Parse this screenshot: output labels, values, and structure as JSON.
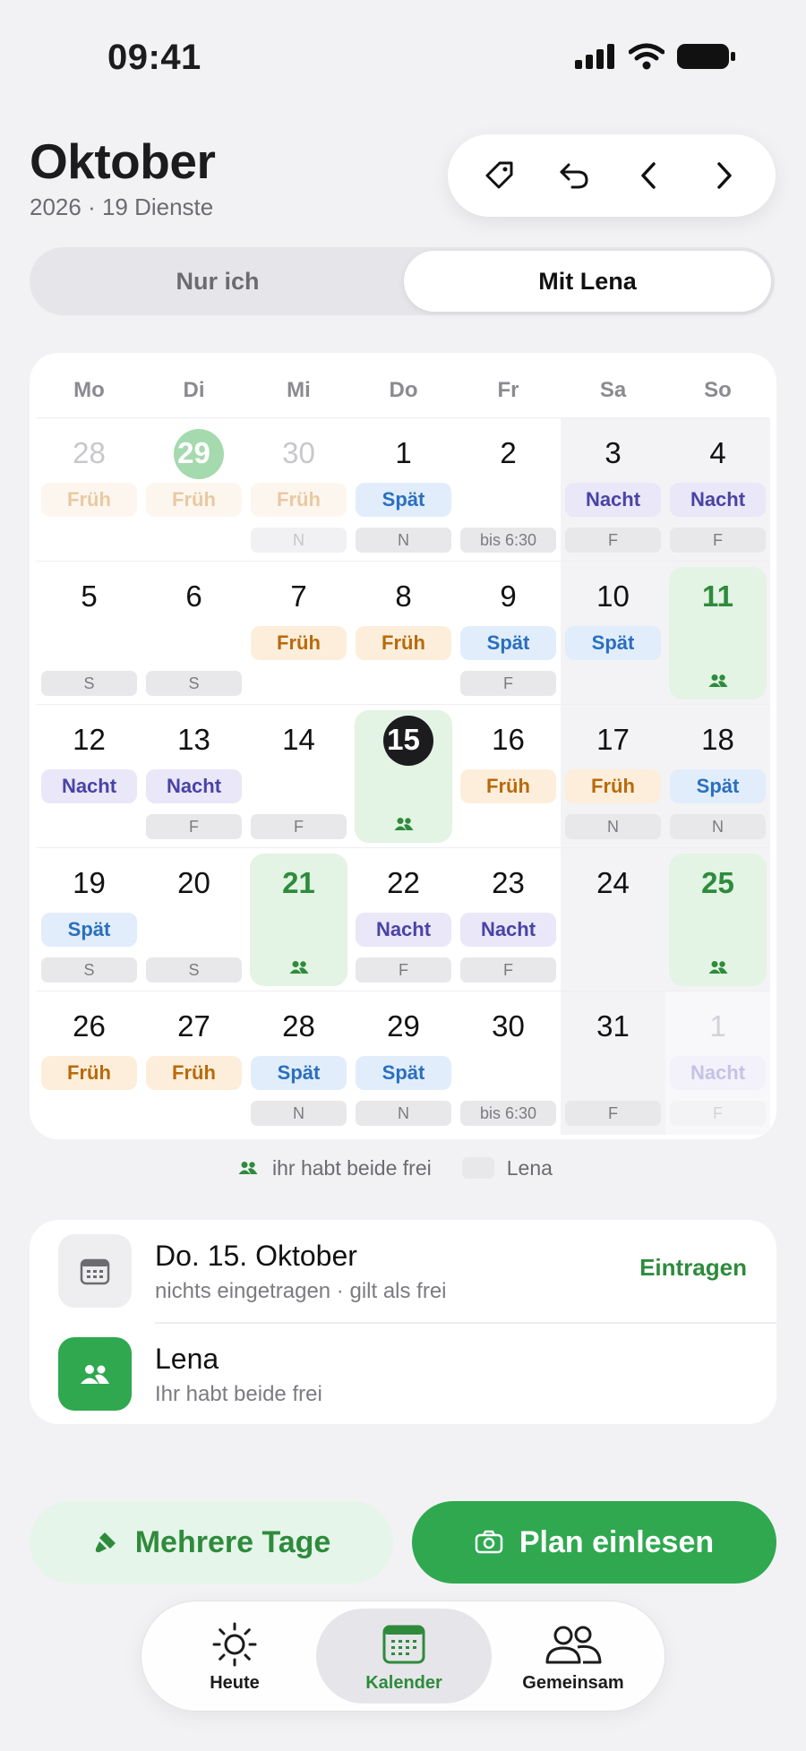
{
  "status_bar": {
    "time": "09:41"
  },
  "header": {
    "month": "Oktober",
    "subtitle": "2026 · 19 Dienste"
  },
  "toolbar": {
    "icons": [
      "tag-icon",
      "undo-icon",
      "chevron-left-icon",
      "chevron-right-icon"
    ]
  },
  "segment": {
    "left": "Nur ich",
    "right": "Mit Lena",
    "selected": "Mit Lena"
  },
  "calendar": {
    "weekdays": [
      "Mo",
      "Di",
      "Mi",
      "Do",
      "Fr",
      "Sa",
      "So"
    ],
    "weeks": [
      [
        {
          "day": "28",
          "shift": "Früh",
          "lena": "",
          "state": "muted"
        },
        {
          "day": "29",
          "shift": "Früh",
          "lena": "",
          "state": "muted-circle"
        },
        {
          "day": "30",
          "shift": "Früh",
          "lena": "N",
          "state": "muted"
        },
        {
          "day": "1",
          "shift": "Spät",
          "lena": "N"
        },
        {
          "day": "2",
          "shift": "",
          "lena": "bis 6:30"
        },
        {
          "day": "3",
          "shift": "Nacht",
          "lena": "F"
        },
        {
          "day": "4",
          "shift": "Nacht",
          "lena": "F"
        }
      ],
      [
        {
          "day": "5",
          "shift": "",
          "lena": "S"
        },
        {
          "day": "6",
          "shift": "",
          "lena": "S"
        },
        {
          "day": "7",
          "shift": "Früh",
          "lena": ""
        },
        {
          "day": "8",
          "shift": "Früh",
          "lena": ""
        },
        {
          "day": "9",
          "shift": "Spät",
          "lena": "F"
        },
        {
          "day": "10",
          "shift": "Spät",
          "lena": ""
        },
        {
          "day": "11",
          "shift": "",
          "lena": "",
          "state": "both-free"
        }
      ],
      [
        {
          "day": "12",
          "shift": "Nacht",
          "lena": ""
        },
        {
          "day": "13",
          "shift": "Nacht",
          "lena": "F"
        },
        {
          "day": "14",
          "shift": "",
          "lena": "F"
        },
        {
          "day": "15",
          "shift": "",
          "lena": "",
          "state": "today-both-free"
        },
        {
          "day": "16",
          "shift": "Früh",
          "lena": ""
        },
        {
          "day": "17",
          "shift": "Früh",
          "lena": "N"
        },
        {
          "day": "18",
          "shift": "Spät",
          "lena": "N"
        }
      ],
      [
        {
          "day": "19",
          "shift": "Spät",
          "lena": "S"
        },
        {
          "day": "20",
          "shift": "",
          "lena": "S"
        },
        {
          "day": "21",
          "shift": "",
          "lena": "",
          "state": "both-free"
        },
        {
          "day": "22",
          "shift": "Nacht",
          "lena": "F"
        },
        {
          "day": "23",
          "shift": "Nacht",
          "lena": "F"
        },
        {
          "day": "24",
          "shift": "",
          "lena": ""
        },
        {
          "day": "25",
          "shift": "",
          "lena": "",
          "state": "both-free"
        }
      ],
      [
        {
          "day": "26",
          "shift": "Früh",
          "lena": ""
        },
        {
          "day": "27",
          "shift": "Früh",
          "lena": ""
        },
        {
          "day": "28",
          "shift": "Spät",
          "lena": "N"
        },
        {
          "day": "29",
          "shift": "Spät",
          "lena": "N"
        },
        {
          "day": "30",
          "shift": "",
          "lena": "bis 6:30"
        },
        {
          "day": "31",
          "shift": "",
          "lena": "F"
        },
        {
          "day": "1",
          "shift": "Nacht",
          "lena": "F",
          "state": "faded"
        }
      ]
    ]
  },
  "legend": {
    "both_free": "ihr habt beide frei",
    "lena": "Lena"
  },
  "detail": {
    "date_title": "Do. 15. Oktober",
    "date_sub": "nichts eingetragen · gilt als frei",
    "action": "Eintragen",
    "partner_title": "Lena",
    "partner_sub": "Ihr habt beide frei"
  },
  "actions": {
    "multi_days": "Mehrere Tage",
    "scan_plan": "Plan einlesen"
  },
  "tabbar": {
    "tabs": [
      {
        "label": "Heute",
        "icon": "sun-icon"
      },
      {
        "label": "Kalender",
        "icon": "calendar-icon",
        "active": true
      },
      {
        "label": "Gemeinsam",
        "icon": "people-icon"
      }
    ]
  },
  "colors": {
    "accent_green": "#2FA84F",
    "frueh": "#B86A0A",
    "spaet": "#2A6FBE",
    "nacht": "#4A43A6"
  }
}
